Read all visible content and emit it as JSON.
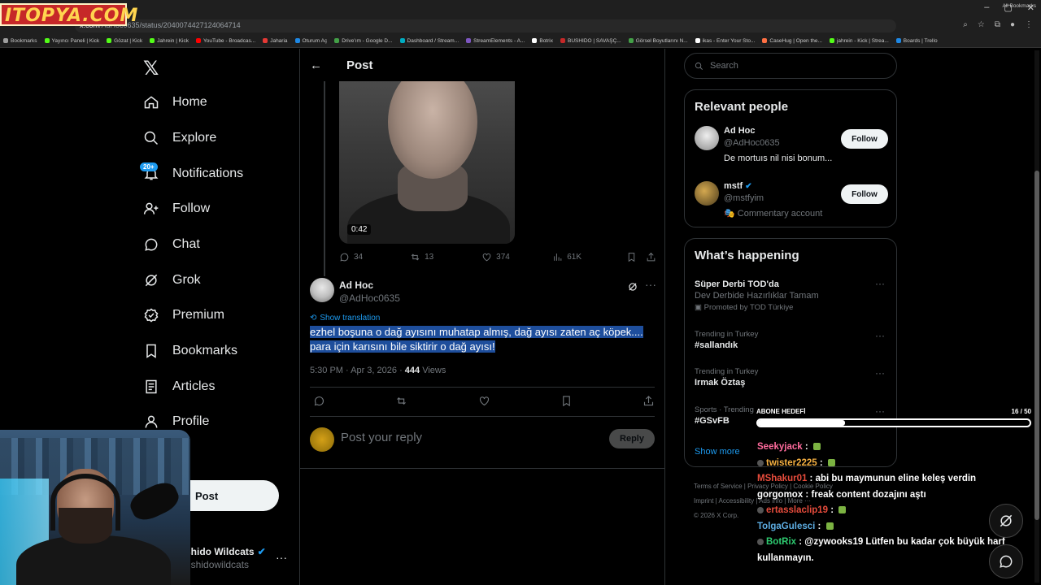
{
  "browser": {
    "url_host": "x.com",
    "url_path": "/AdHoc0635/status/2040074427124064714",
    "watermark": "ITOPYA.COM",
    "bookmarks": [
      {
        "label": "Bookmarks",
        "color": "#9e9e9e"
      },
      {
        "label": "Yayıncı Paneli | Kick",
        "color": "#53fc18"
      },
      {
        "label": "Gözat | Kick",
        "color": "#53fc18"
      },
      {
        "label": "Jahrein | Kick",
        "color": "#53fc18"
      },
      {
        "label": "YouTube - Broadcas...",
        "color": "#ff0000"
      },
      {
        "label": "Jaharia",
        "color": "#e53935"
      },
      {
        "label": "Oturum Aç",
        "color": "#1e88e5"
      },
      {
        "label": "Drive'ım - Google D...",
        "color": "#43a047"
      },
      {
        "label": "Dashboard / Stream...",
        "color": "#00acc1"
      },
      {
        "label": "StreamElements - A...",
        "color": "#7e57c2"
      },
      {
        "label": "Botrix",
        "color": "#ffffff"
      },
      {
        "label": "BUSHIDO | SAVAŞÇ...",
        "color": "#c62828"
      },
      {
        "label": "Görsel Boyutlarını N...",
        "color": "#43a047"
      },
      {
        "label": "ikas - Enter Your Sto...",
        "color": "#ffffff"
      },
      {
        "label": "CaseHug | Open the...",
        "color": "#ff7043"
      },
      {
        "label": "jahrein - Kick | Strea...",
        "color": "#53fc18"
      },
      {
        "label": "Boards | Trello",
        "color": "#1e88e5"
      }
    ],
    "all_bookmarks": "All Bookmarks"
  },
  "nav": {
    "logo": "𝕏",
    "items": [
      {
        "label": "Home",
        "icon": "home-icon"
      },
      {
        "label": "Explore",
        "icon": "search-icon"
      },
      {
        "label": "Notifications",
        "icon": "bell-icon"
      },
      {
        "label": "Follow",
        "icon": "follow-icon"
      },
      {
        "label": "Chat",
        "icon": "chat-icon"
      },
      {
        "label": "Grok",
        "icon": "grok-icon"
      },
      {
        "label": "Premium",
        "icon": "premium-icon"
      },
      {
        "label": "Bookmarks",
        "icon": "bookmark-icon"
      },
      {
        "label": "Articles",
        "icon": "articles-icon"
      },
      {
        "label": "Profile",
        "icon": "profile-icon"
      },
      {
        "label": "re",
        "icon": "more-icon"
      }
    ],
    "notifications_badge": "20+",
    "post_button": "Post",
    "account_name": "shido Wildcats",
    "account_handle": "ushidowildcats"
  },
  "post": {
    "header": "Post",
    "video_duration": "0:42",
    "parent_stats": {
      "replies": "34",
      "reposts": "13",
      "likes": "374",
      "views": "61K"
    },
    "author_name": "Ad Hoc",
    "author_handle": "@AdHoc0635",
    "show_translation": "Show translation",
    "text_line1": "ezhel boşuna o dağ ayısını muhatap almış, dağ ayısı zaten aç köpek....",
    "text_line2": "para için karısını bile siktirir o dağ ayısı!",
    "timestamp": "5:30 PM · Apr 3, 2026 · ",
    "views": "444",
    "views_label": " Views",
    "reply_placeholder": "Post your reply",
    "reply_button": "Reply"
  },
  "sidebar": {
    "search_placeholder": "Search",
    "relevant_title": "Relevant people",
    "people": [
      {
        "name": "Ad Hoc",
        "handle": "@AdHoc0635",
        "bio": "De mortuıs nil nisi bonum...",
        "follow": "Follow",
        "verified": false
      },
      {
        "name": "mstf",
        "handle": "@mstfyim",
        "bio": "🎭 Commentary account",
        "follow": "Follow",
        "verified": true
      }
    ],
    "happening_title": "What’s happening",
    "trends": [
      {
        "ctx": "",
        "title": "Süper Derbi TOD'da",
        "sub": "Dev Derbide Hazırlıklar Tamam",
        "promo": "Promoted by TOD Türkiye"
      },
      {
        "ctx": "Trending in Turkey",
        "title": "#sallandık",
        "sub": "",
        "promo": ""
      },
      {
        "ctx": "Trending in Turkey",
        "title": "Irmak Öztaş",
        "sub": "",
        "promo": ""
      },
      {
        "ctx": "Sports · Trending",
        "title": "#GSvFB",
        "sub": "",
        "promo": ""
      }
    ],
    "show_more": "Show more",
    "footer_line1": "Terms of Service  |  Privacy Policy  |  Cookie Policy",
    "footer_line2": "Imprint  |  Accessibility  |  Ads info  |  More ···",
    "footer_line3": "© 2026 X Corp."
  },
  "overlay": {
    "subgoal_label": "ABONE HEDEFİ",
    "subgoal_count": "16 / 50",
    "subgoal_progress": 0.32,
    "chat": [
      {
        "user": "Seekyjack",
        "color": "#ff6b9d",
        "msg": "",
        "emote": true,
        "badge": false
      },
      {
        "user": "twister2225",
        "color": "#f5b041",
        "msg": "",
        "emote": true,
        "badge": true
      },
      {
        "user": "MShakur01",
        "color": "#e74c3c",
        "msg": "abi bu maymunun eline keleş verdin",
        "emote": false,
        "badge": false
      },
      {
        "user": "gorgomox",
        "color": "#ffffff",
        "msg": "freak content dozajını aştı",
        "emote": false,
        "badge": false
      },
      {
        "user": "ertasslaclip19",
        "color": "#e74c3c",
        "msg": "",
        "emote": true,
        "badge": true
      },
      {
        "user": "TolgaGulesci",
        "color": "#5dade2",
        "msg": "",
        "emote": true,
        "badge": false
      },
      {
        "user": "BotRix",
        "color": "#2ecc71",
        "msg": "@zywooks19 Lütfen bu kadar çok büyük harf",
        "emote": false,
        "badge": true
      },
      {
        "user": "",
        "color": "#ffffff",
        "msg": "kullanmayın.",
        "emote": false,
        "badge": false
      }
    ]
  }
}
